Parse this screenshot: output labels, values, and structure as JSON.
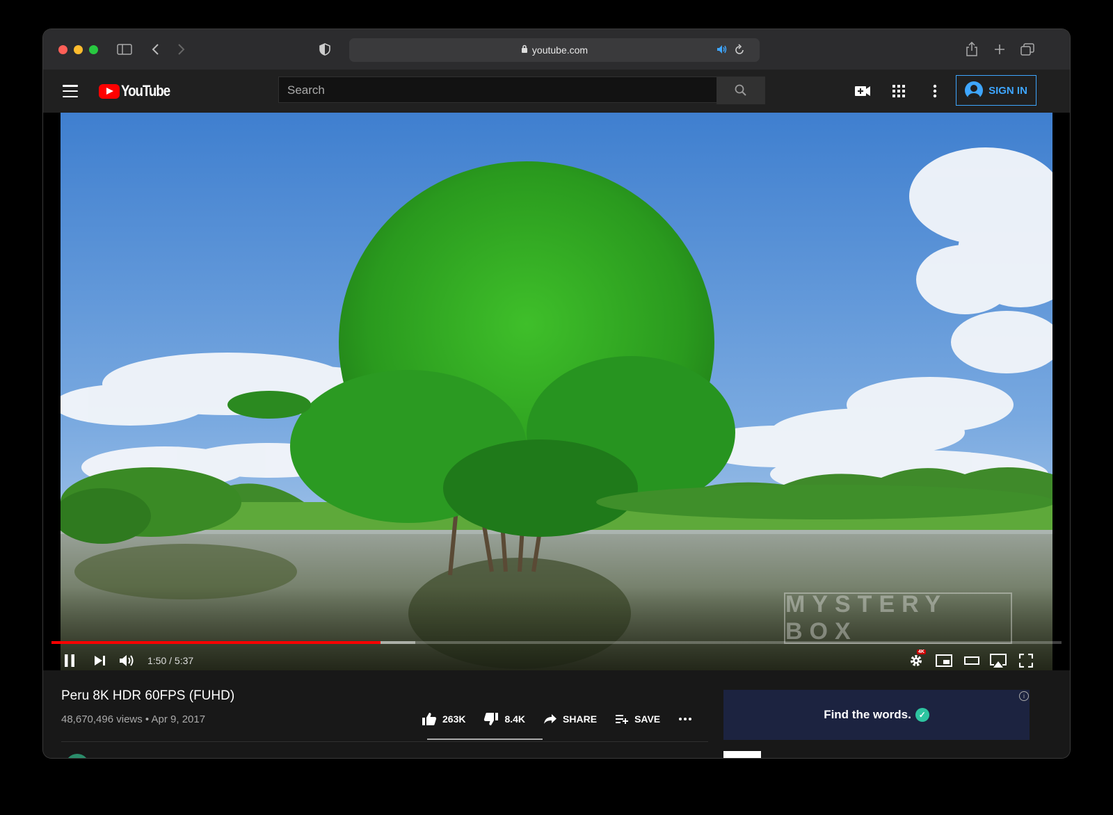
{
  "browser": {
    "url": "youtube.com"
  },
  "header": {
    "logo_text": "YouTube",
    "search_placeholder": "Search",
    "sign_in_label": "SIGN IN"
  },
  "player": {
    "current_time": "1:50",
    "duration": "5:37",
    "time_display": "1:50 / 5:37",
    "watermark": "MYSTERY BOX",
    "progress_fraction": 0.326,
    "buffered_fraction": 0.36,
    "quality_badge": "4K"
  },
  "video": {
    "title": "Peru 8K HDR 60FPS (FUHD)",
    "views": "48,670,496 views",
    "date": "Apr 9, 2017",
    "meta_line": "48,670,496 views • Apr 9, 2017"
  },
  "actions": {
    "likes": "263K",
    "dislikes": "8.4K",
    "share": "SHARE",
    "save": "SAVE"
  },
  "ad": {
    "text": "Find the words.",
    "info": "i"
  },
  "colors": {
    "accent_red": "#ff0000",
    "signin_blue": "#3ea6ff"
  }
}
